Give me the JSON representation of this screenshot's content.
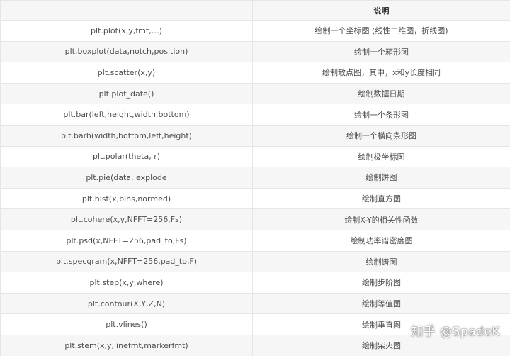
{
  "table": {
    "headers": [
      "",
      "说明"
    ],
    "rows": [
      {
        "func": "plt.plot(x,y,fmt,…)",
        "desc": "绘制一个坐标图 (线性二维图，折线图)"
      },
      {
        "func": "plt.boxplot(data,notch,position)",
        "desc": "绘制一个箱形图"
      },
      {
        "func": "plt.scatter(x,y)",
        "desc": "绘制散点图，其中，x和y长度相同"
      },
      {
        "func": "plt.plot_date()",
        "desc": "绘制数据日期"
      },
      {
        "func": "plt.bar(left,height,width,bottom)",
        "desc": "绘制一个条形图"
      },
      {
        "func": "plt.barh(width,bottom,left,height)",
        "desc": "绘制一个横向条形图"
      },
      {
        "func": "plt.polar(theta, r)",
        "desc": "绘制极坐标图"
      },
      {
        "func": "plt.pie(data, explode",
        "desc": "绘制饼图"
      },
      {
        "func": "plt.hist(x,bins,normed)",
        "desc": "绘制直方图"
      },
      {
        "func": "plt.cohere(x,y,NFFT=256,Fs)",
        "desc": "绘制X-Y的相关性函数"
      },
      {
        "func": "plt.psd(x,NFFT=256,pad_to,Fs)",
        "desc": "绘制功率谱密度图"
      },
      {
        "func": "plt.specgram(x,NFFT=256,pad_to,F)",
        "desc": "绘制谱图"
      },
      {
        "func": "plt.step(x,y,where)",
        "desc": "绘制步阶图"
      },
      {
        "func": "plt.contour(X,Y,Z,N)",
        "desc": "绘制等值图"
      },
      {
        "func": "plt.vlines()",
        "desc": "绘制垂直图"
      },
      {
        "func": "plt.stem(x,y,linefmt,markerfmt)",
        "desc": "绘制柴火图"
      }
    ]
  },
  "watermark": "知乎 @SpadeK"
}
